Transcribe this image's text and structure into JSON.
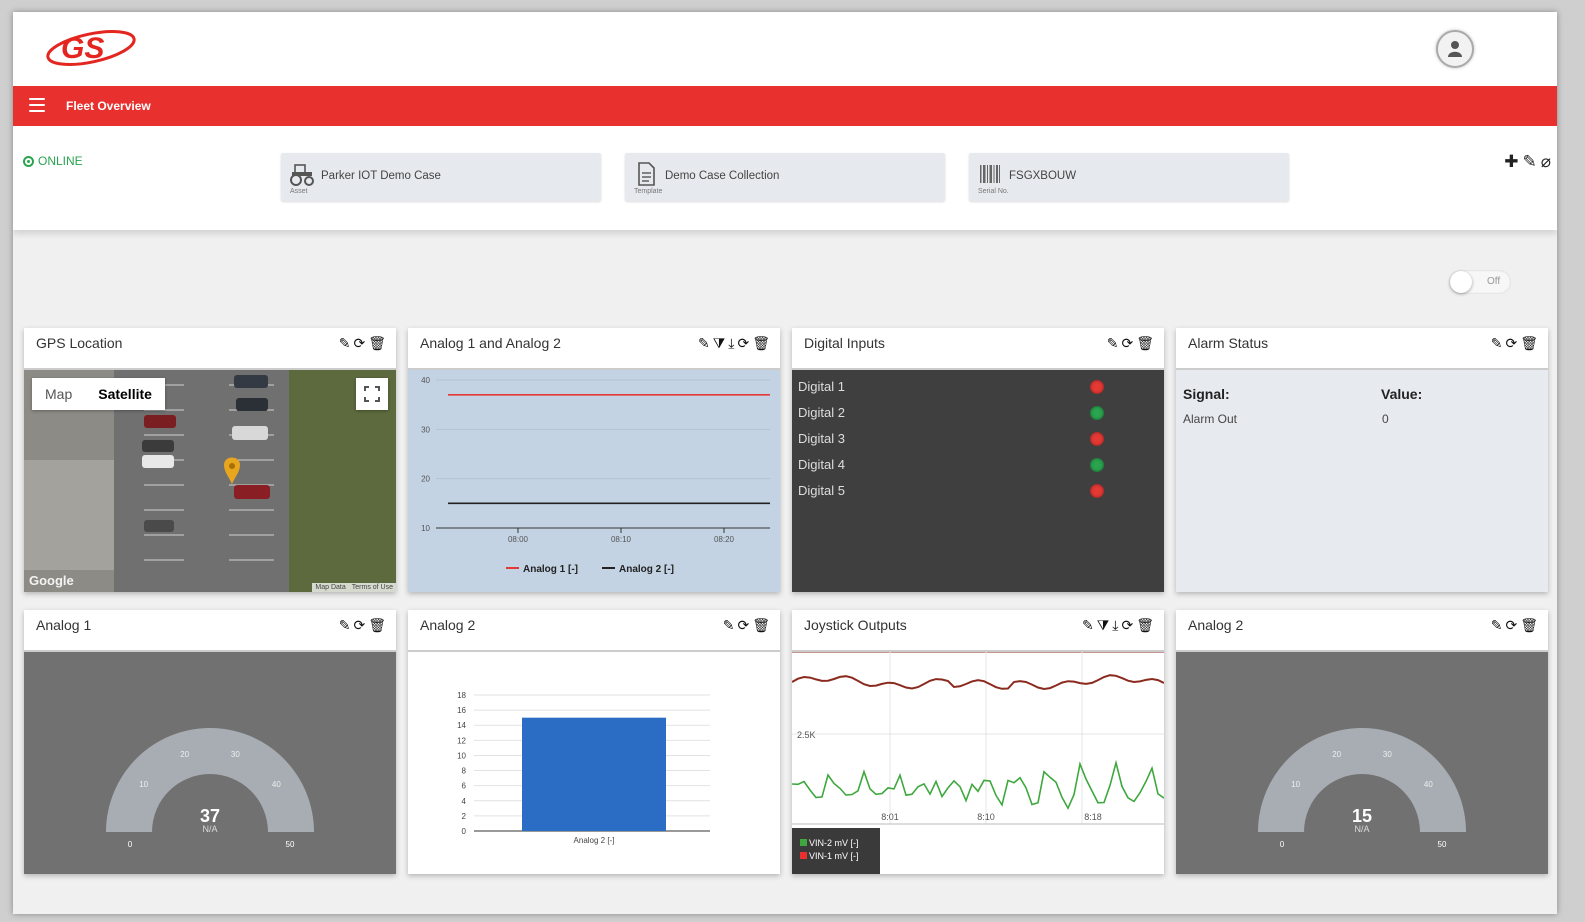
{
  "header": {
    "logo_text": "GS",
    "user_button": "user-avatar"
  },
  "nav": {
    "title": "Fleet Overview"
  },
  "info": {
    "status": "ONLINE",
    "chips": [
      {
        "value": "Parker IOT Demo Case",
        "label": "Asset",
        "icon": "tractor-icon"
      },
      {
        "value": "Demo Case Collection",
        "label": "Template",
        "icon": "document-icon"
      },
      {
        "value": "FSGXBOUW",
        "label": "Serial No.",
        "icon": "barcode-icon"
      }
    ],
    "actions": [
      "add-icon",
      "edit-icon",
      "attach-icon"
    ]
  },
  "toggle": {
    "label": "Off",
    "state": "off"
  },
  "widgets": {
    "gps": {
      "title": "GPS Location",
      "map_tab": "Map",
      "satellite_tab": "Satellite",
      "google": "Google",
      "map_data": "Map Data",
      "terms": "Terms of Use"
    },
    "analog12": {
      "title": "Analog 1 and Analog 2"
    },
    "digital": {
      "title": "Digital Inputs",
      "rows": [
        {
          "label": "Digital 1",
          "color": "#e53935"
        },
        {
          "label": "Digital 2",
          "color": "#2aa44f"
        },
        {
          "label": "Digital 3",
          "color": "#e53935"
        },
        {
          "label": "Digital 4",
          "color": "#2aa44f"
        },
        {
          "label": "Digital 5",
          "color": "#e53935"
        }
      ]
    },
    "alarm": {
      "title": "Alarm Status",
      "signal_header": "Signal:",
      "value_header": "Value:",
      "signal": "Alarm Out",
      "value": "0"
    },
    "analog1": {
      "title": "Analog 1",
      "value": "37",
      "unit": "N/A"
    },
    "analog2bar": {
      "title": "Analog 2"
    },
    "joystick": {
      "title": "Joystick Outputs"
    },
    "analog2gauge": {
      "title": "Analog 2",
      "value": "15",
      "unit": "N/A"
    }
  },
  "chart_data": [
    {
      "type": "line",
      "x": [
        "08:00",
        "08:10",
        "08:20"
      ],
      "ylim": [
        10,
        40
      ],
      "yticks": [
        10,
        20,
        30,
        40
      ],
      "series": [
        {
          "name": "Analog 1 [-]",
          "color": "#e53935",
          "values": [
            37,
            37,
            37
          ]
        },
        {
          "name": "Analog 2 [-]",
          "color": "#222222",
          "values": [
            15,
            15,
            15
          ]
        }
      ],
      "legend": "bottom"
    },
    {
      "type": "bar",
      "categories": [
        "Analog 2 [-]"
      ],
      "values": [
        15
      ],
      "ylim": [
        0,
        18
      ],
      "yticks": [
        0,
        2,
        4,
        6,
        8,
        10,
        12,
        14,
        16,
        18
      ],
      "color": "#2b6cc4"
    },
    {
      "type": "line",
      "x": [
        "8:01",
        "8:10",
        "8:18"
      ],
      "ytick_label": "2.5K",
      "series": [
        {
          "name": "VIN-2 mV [-]",
          "color": "#3ea83e"
        },
        {
          "name": "VIN-1 mV [-]",
          "color": "#8b2a1e"
        }
      ],
      "legend": "bottom-left"
    },
    {
      "type": "gauge",
      "value": 37,
      "range": [
        0,
        50
      ],
      "ticks": [
        0,
        10,
        20,
        30,
        40,
        50
      ],
      "unit": "N/A"
    },
    {
      "type": "gauge",
      "value": 15,
      "range": [
        0,
        50
      ],
      "ticks": [
        0,
        10,
        20,
        30,
        40,
        50
      ],
      "unit": "N/A"
    }
  ]
}
